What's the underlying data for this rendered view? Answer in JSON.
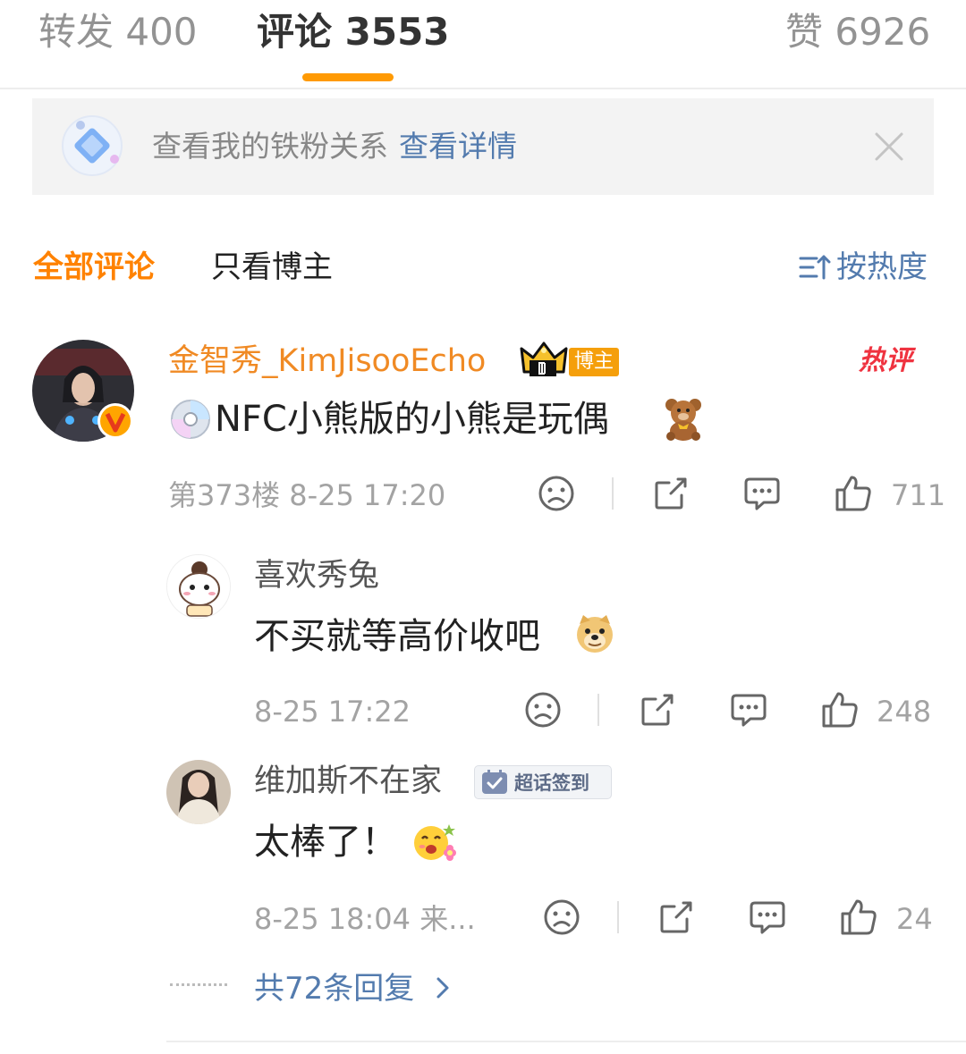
{
  "tabs": [
    {
      "label": "转发 400"
    },
    {
      "label": "评论 3553"
    },
    {
      "label": "赞 6926"
    }
  ],
  "banner": {
    "text": "查看我的铁粉关系",
    "link": "查看详情"
  },
  "filters": {
    "all": "全部评论",
    "host_only": "只看博主",
    "sort": "按热度"
  },
  "comment": {
    "user": "金智秀_KimJisooEcho",
    "badge": "博主",
    "hot_label": "热评",
    "text": "NFC小熊版的小熊是玩偶",
    "meta": "第373楼 8-25 17:20",
    "likes": "711"
  },
  "replies": [
    {
      "user": "喜欢秀兔",
      "text": "不买就等高价收吧",
      "meta": "8-25 17:22",
      "likes": "248"
    },
    {
      "user": "维加斯不在家",
      "badge": "超话签到",
      "text": "太棒了！",
      "meta": "8-25 18:04 来...",
      "likes": "24"
    }
  ],
  "more_replies": "共72条回复",
  "colors": {
    "accent_orange": "#ff8200",
    "link_blue": "#537bae",
    "host_badge": "#f59f0b"
  },
  "icons": [
    "fan-diamond-icon",
    "close-icon",
    "sort-icon",
    "verified-v-icon",
    "crown-icon",
    "cd-emoji-icon",
    "teddy-bear-emoji-icon",
    "doge-emoji-icon",
    "happy-flower-emoji-icon",
    "dislike-face-icon",
    "share-icon",
    "comment-icon",
    "like-thumb-icon",
    "chevron-right-icon",
    "checkin-icon"
  ]
}
